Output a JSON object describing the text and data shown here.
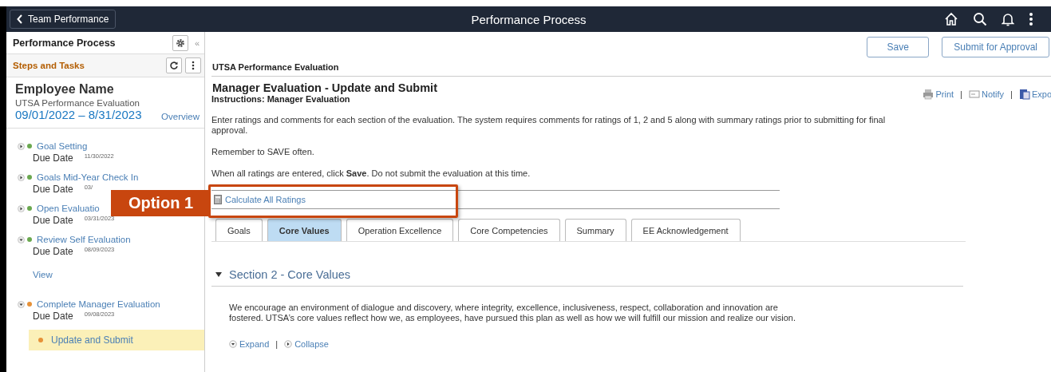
{
  "top_bar": {
    "back_button": "Team Performance",
    "title": "Performance Process"
  },
  "sidebar": {
    "title": "Performance Process",
    "collapse_glyph": "«",
    "subtitle": "Steps and Tasks",
    "employee_name": "Employee Name",
    "plan": "UTSA Performance Evaluation",
    "period": "09/01/2022 – 8/31/2023",
    "overview_link": "Overview",
    "steps": [
      {
        "title": "Goal Setting",
        "expanded": false,
        "color": "#6aa84f",
        "due_label": "Due Date",
        "due_date": "11/30/2022"
      },
      {
        "title": "Goals Mid-Year Check In",
        "expanded": false,
        "color": "#6aa84f",
        "due_label": "Due Date",
        "due_date": "03/"
      },
      {
        "title": "Open Evaluatio",
        "expanded": false,
        "color": "#6aa84f",
        "due_label": "Due Date",
        "due_date": "03/31/2023"
      },
      {
        "title": "Review Self Evaluation",
        "expanded": true,
        "color": "#6aa84f",
        "due_label": "Due Date",
        "due_date": "08/09/2023",
        "children": [
          {
            "kind": "link",
            "label": "View",
            "selected": false
          }
        ]
      },
      {
        "title": "Complete Manager Evaluation",
        "expanded": true,
        "color": "#e69138",
        "due_label": "Due Date",
        "due_date": "09/08/2023",
        "children": [
          {
            "kind": "task",
            "label": "Update and Submit",
            "selected": true,
            "color": "#e69138"
          }
        ]
      }
    ]
  },
  "actions": [
    "Save",
    "Submit for Approval"
  ],
  "page_label": "UTSA Performance Evaluation",
  "heading": "Manager Evaluation - Update and Submit",
  "instructions": "Instructions: Manager Evaluation",
  "page_links": [
    {
      "kind": "link",
      "label": "Print"
    },
    {
      "kind": "separator",
      "label": "|"
    },
    {
      "kind": "link",
      "label": "Notify"
    },
    {
      "kind": "separator",
      "label": "|"
    },
    {
      "kind": "link",
      "label": "Expo"
    }
  ],
  "paragraphs": [
    "Enter ratings and comments for each section of the evaluation. The system requires comments for ratings of 1, 2 and 5 along with summary ratings prior to submitting for final approval.",
    "Remember to SAVE often.",
    "When all ratings are entered, click **Save**. Do not submit the evaluation at this time."
  ],
  "calculate_link": "Calculate All Ratings",
  "callout": "Option 1",
  "tabs": [
    {
      "label": "Goals",
      "selected": false
    },
    {
      "label": "Core Values",
      "selected": true
    },
    {
      "label": "Operation Excellence",
      "selected": false
    },
    {
      "label": "Core Competencies",
      "selected": false
    },
    {
      "label": "Summary",
      "selected": false
    },
    {
      "label": "EE Acknowledgement",
      "selected": false
    }
  ],
  "section": {
    "title": "Section 2 - Core Values",
    "expanded": true,
    "text": "We encourage an environment of dialogue and discovery, where integrity, excellence, inclusiveness, respect, collaboration and innovation are fostered. UTSA’s core values reflect how we, as employees, have pursued this plan as well as how we will fulfill our mission and realize our vision.",
    "links": [
      {
        "kind": "link",
        "label": "Expand"
      },
      {
        "kind": "separator",
        "label": "|"
      },
      {
        "kind": "link",
        "label": "Collapse"
      }
    ]
  }
}
